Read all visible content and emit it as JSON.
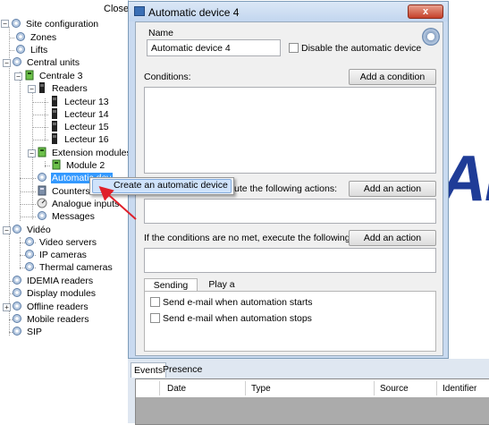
{
  "tree": {
    "close_label": "Close",
    "items": [
      {
        "label": "Site configuration"
      },
      {
        "label": "Zones"
      },
      {
        "label": "Lifts"
      },
      {
        "label": "Central units"
      },
      {
        "label": "Centrale 3"
      },
      {
        "label": "Readers"
      },
      {
        "label": "Lecteur 13"
      },
      {
        "label": "Lecteur 14"
      },
      {
        "label": "Lecteur 15"
      },
      {
        "label": "Lecteur 16"
      },
      {
        "label": "Extension modules"
      },
      {
        "label": "Module 2"
      },
      {
        "label": "Automatic dev"
      },
      {
        "label": "Counters"
      },
      {
        "label": "Analogue inputs"
      },
      {
        "label": "Messages"
      },
      {
        "label": "Vidéo"
      },
      {
        "label": "Video servers"
      },
      {
        "label": "IP cameras"
      },
      {
        "label": "Thermal cameras"
      },
      {
        "label": "IDEMIA readers"
      },
      {
        "label": "Display modules"
      },
      {
        "label": "Offline readers"
      },
      {
        "label": "Mobile readers"
      },
      {
        "label": "SIP"
      }
    ]
  },
  "dialog": {
    "title": "Automatic device 4",
    "close_glyph": "x",
    "name_label": "Name",
    "name_value": "Automatic device 4",
    "disable_label": "Disable the automatic device",
    "conditions_label": "Conditions:",
    "add_condition_label": "Add a condition",
    "met_actions_label": "ute the following actions:",
    "add_action_label": "Add an action",
    "not_met_label": "If the conditions are no met, execute the following actions:",
    "add_action_label_2": "Add an action",
    "tab_emails": "Sending emails",
    "tab_sound": "Play a sound",
    "send_start_label": "Send e-mail when automation starts",
    "send_stop_label": "Send e-mail when automation stops"
  },
  "events": {
    "tab_events": "Events",
    "tab_presence": "Presence",
    "columns": [
      "Date",
      "Type",
      "Source",
      "Identifier"
    ]
  },
  "context_menu": {
    "item": "Create an automatic device"
  },
  "background": {
    "partial_text": "AI"
  },
  "colors": {
    "selection": "#3399ff",
    "menu_highlight": "#cfe3fb",
    "window_chrome": "#c9daf0",
    "arrow": "#e0202a",
    "logo": "#1f3c97"
  }
}
